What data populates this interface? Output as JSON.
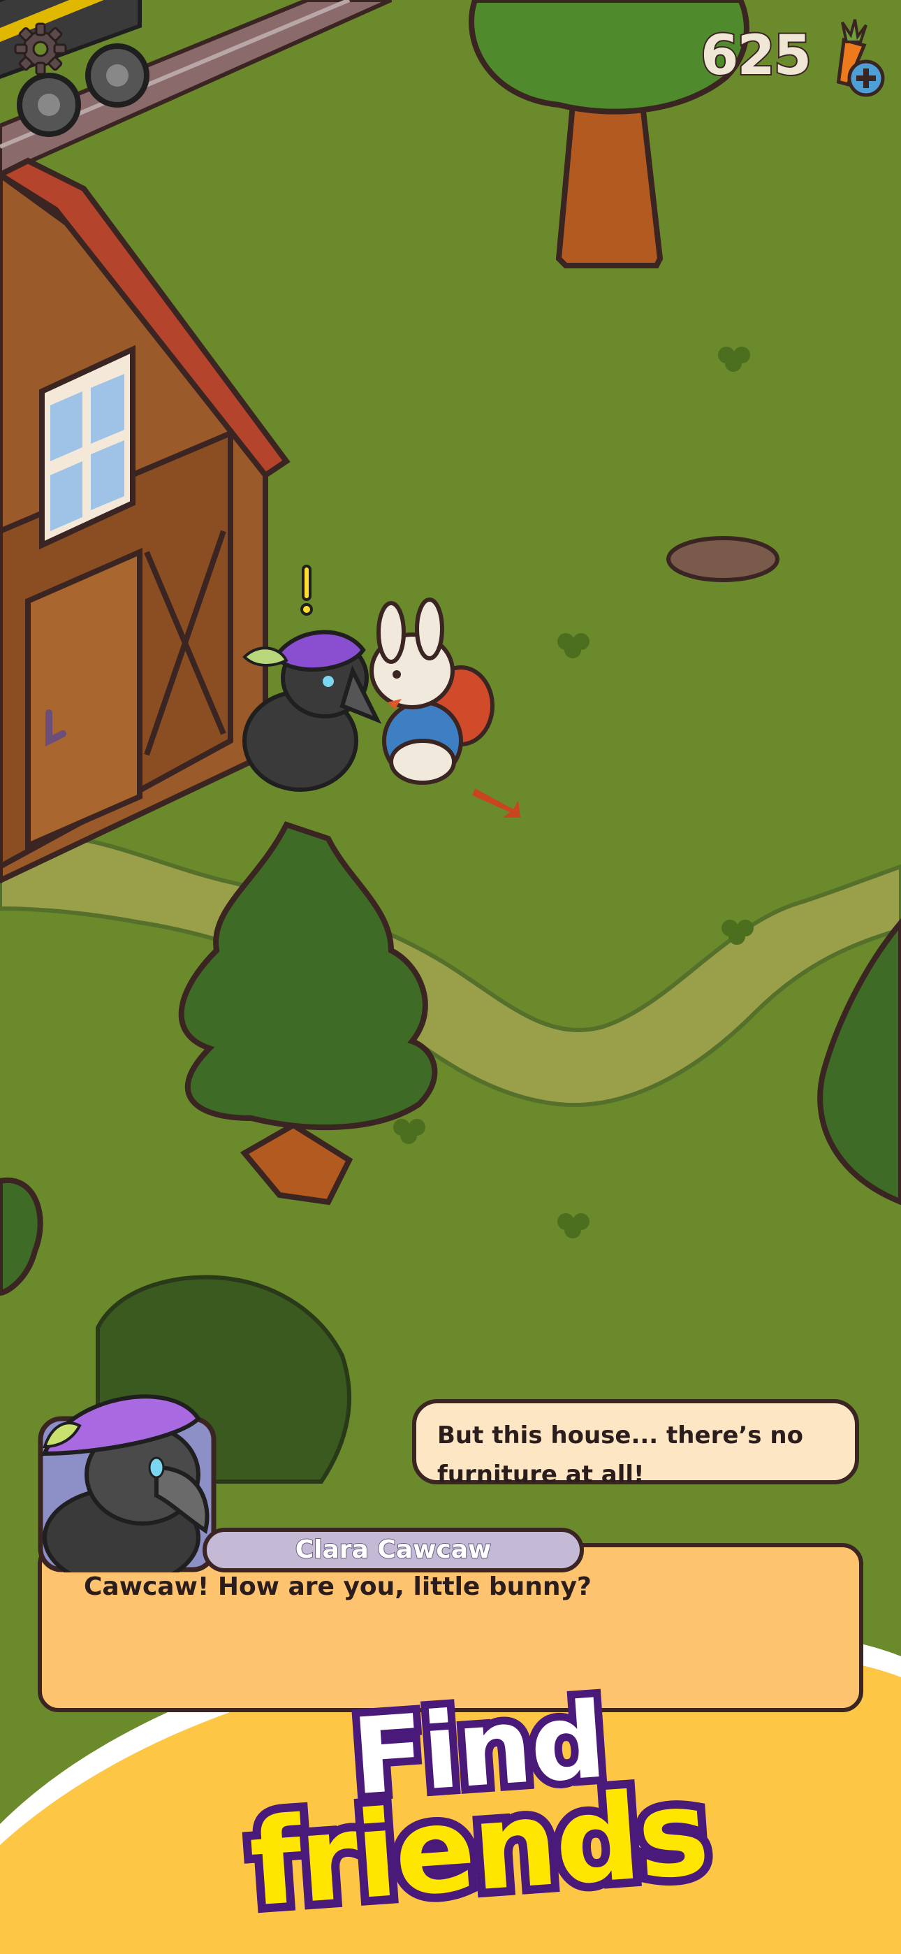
{
  "hud": {
    "settings_icon": "gear-icon",
    "currency_amount": "625",
    "currency_icon": "carrot-icon",
    "add_icon": "plus-icon"
  },
  "dialogue": {
    "speaker_name": "Clara Cawcaw",
    "speaker_line": "Cawcaw! How are you, little bunny?",
    "reply_lines": [
      "But this house... there’s no",
      "furniture at all!"
    ]
  },
  "promo": {
    "line1": "Find",
    "line2": "friends"
  },
  "colors": {
    "grass": "#6b8a2c",
    "path": "#9aa04a",
    "outline": "#3b2523",
    "dialogue_box": "#fdc36f",
    "reply_bubble": "#fce6c3",
    "name_plate": "#c4bad6",
    "banner": "#fdc645",
    "promo_purple": "#4a1a7a",
    "promo_yellow": "#ffe600"
  }
}
